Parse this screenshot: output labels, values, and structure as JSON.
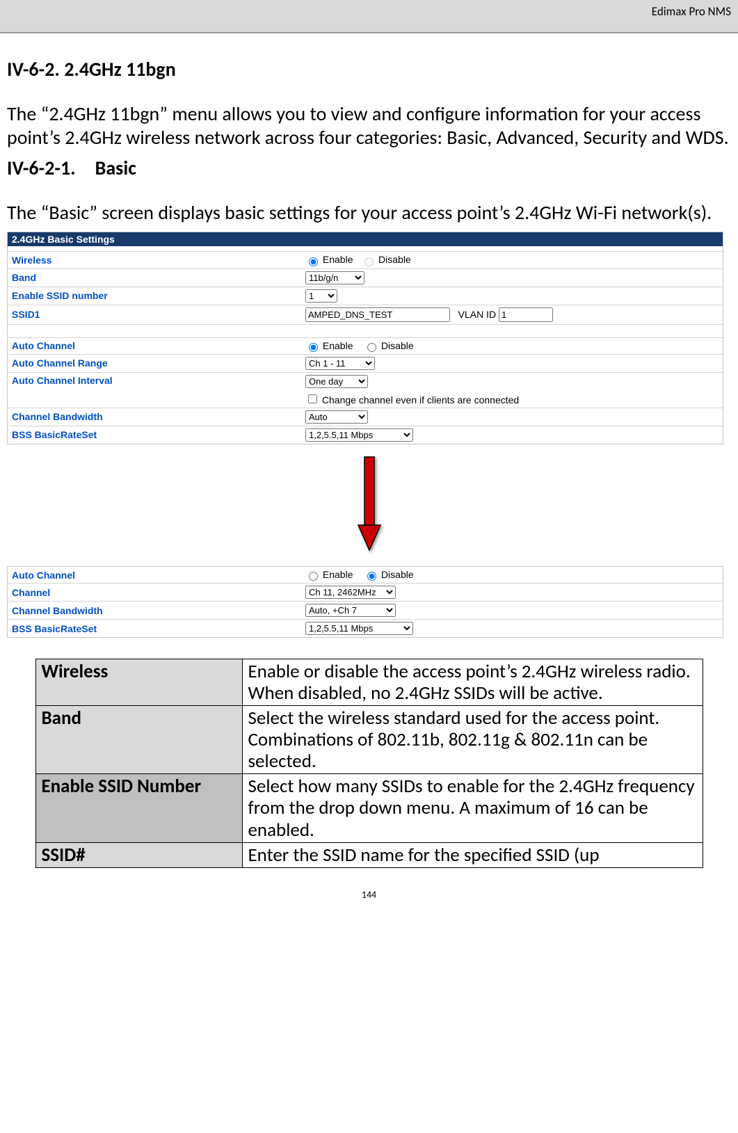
{
  "header": {
    "product": "Edimax Pro NMS"
  },
  "section": {
    "title": "IV-6-2. 2.4GHz 11bgn",
    "intro": "The “2.4GHz 11bgn” menu allows you to view and configure information for your access point’s 2.4GHz wireless network across four categories: Basic, Advanced, Security and WDS.",
    "sub_title": "IV-6-2-1. Basic",
    "sub_intro": "The “Basic” screen displays basic settings for your access point’s 2.4GHz Wi-Fi network(s)."
  },
  "panel1": {
    "header": "2.4GHz Basic Settings",
    "rows": {
      "wireless": {
        "label": "Wireless",
        "enable": "Enable",
        "disable": "Disable"
      },
      "band": {
        "label": "Band",
        "value": "11b/g/n"
      },
      "enable_ssid_number": {
        "label": "Enable SSID number",
        "value": "1"
      },
      "ssid1": {
        "label": "SSID1",
        "value": "AMPED_DNS_TEST",
        "vlan_label": "VLAN ID",
        "vlan_value": "1"
      },
      "auto_channel": {
        "label": "Auto Channel",
        "enable": "Enable",
        "disable": "Disable"
      },
      "auto_channel_range": {
        "label": "Auto Channel Range",
        "value": "Ch 1 - 11"
      },
      "auto_channel_interval": {
        "label": "Auto Channel Interval",
        "value": "One day",
        "checkbox_label": "Change channel even if clients are connected"
      },
      "channel_bandwidth": {
        "label": "Channel Bandwidth",
        "value": "Auto"
      },
      "bss_basic_rate_set": {
        "label": "BSS BasicRateSet",
        "value": "1,2,5.5,11 Mbps"
      }
    }
  },
  "panel2": {
    "rows": {
      "auto_channel": {
        "label": "Auto Channel",
        "enable": "Enable",
        "disable": "Disable"
      },
      "channel": {
        "label": "Channel",
        "value": "Ch 11, 2462MHz"
      },
      "channel_bandwidth": {
        "label": "Channel Bandwidth",
        "value": "Auto, +Ch 7"
      },
      "bss_basic_rate_set": {
        "label": "BSS BasicRateSet",
        "value": "1,2,5.5,11 Mbps"
      }
    }
  },
  "desc_table": {
    "wireless": {
      "label": "Wireless",
      "text": "Enable or disable the access point’s 2.4GHz wireless radio. When disabled, no 2.4GHz SSIDs will be active."
    },
    "band": {
      "label": "Band",
      "text": "Select the wireless standard used for the access point. Combinations of 802.11b, 802.11g & 802.11n can be selected."
    },
    "enable_ssid_number": {
      "label": "Enable SSID Number",
      "text": "Select how many SSIDs to enable for the 2.4GHz frequency from the drop down menu. A maximum of 16 can be enabled."
    },
    "ssid_num": {
      "label": "SSID#",
      "text": "Enter the SSID name for the specified SSID (up"
    }
  },
  "page_number": "144"
}
